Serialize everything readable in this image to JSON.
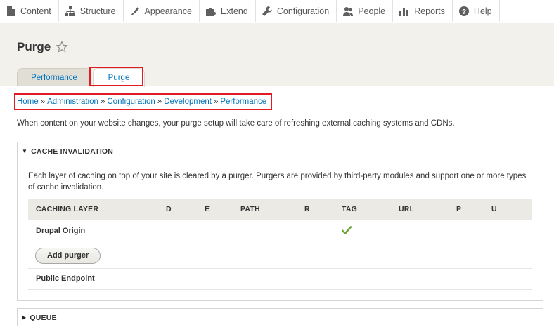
{
  "toolbar": {
    "items": [
      {
        "label": "Content",
        "icon": "content-icon"
      },
      {
        "label": "Structure",
        "icon": "structure-icon"
      },
      {
        "label": "Appearance",
        "icon": "appearance-icon"
      },
      {
        "label": "Extend",
        "icon": "extend-icon"
      },
      {
        "label": "Configuration",
        "icon": "wrench-icon"
      },
      {
        "label": "People",
        "icon": "people-icon"
      },
      {
        "label": "Reports",
        "icon": "reports-icon"
      },
      {
        "label": "Help",
        "icon": "help-icon"
      }
    ]
  },
  "header": {
    "title": "Purge",
    "tabs": [
      {
        "label": "Performance",
        "active": false
      },
      {
        "label": "Purge",
        "active": true
      }
    ]
  },
  "breadcrumb": {
    "items": [
      "Home",
      "Administration",
      "Configuration",
      "Development",
      "Performance"
    ],
    "separator": "»"
  },
  "intro": "When content on your website changes, your purge setup will take care of refreshing external caching systems and CDNs.",
  "cache_invalidation": {
    "summary": "CACHE INVALIDATION",
    "description": "Each layer of caching on top of your site is cleared by a purger. Purgers are provided by third-party modules and support one or more types of cache invalidation.",
    "columns": [
      "CACHING LAYER",
      "D",
      "E",
      "PATH",
      "R",
      "TAG",
      "URL",
      "P",
      "U"
    ],
    "rows": [
      {
        "name": "Drupal Origin",
        "tag_supported": true
      },
      {
        "button": "Add purger"
      },
      {
        "name": "Public Endpoint"
      }
    ]
  },
  "queue": {
    "summary": "QUEUE"
  },
  "colors": {
    "link": "#0074bd",
    "highlight": "#e31b23",
    "check": "#6fa33a",
    "header_bg": "#f2f1eb"
  }
}
